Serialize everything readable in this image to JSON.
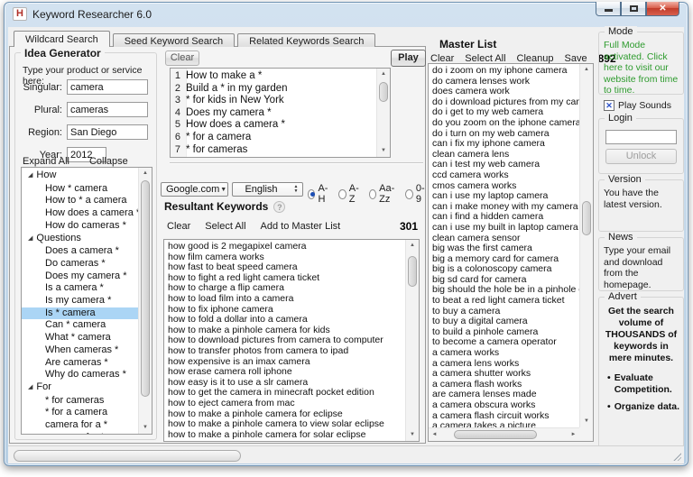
{
  "window": {
    "title": "Keyword Researcher 6.0"
  },
  "icons": {
    "app": "H",
    "close": "✕",
    "expander": "◢",
    "dropdown": "▼",
    "spin_up": "▲",
    "spin_down": "▼",
    "scroll_up": "▲",
    "scroll_down": "▼",
    "scroll_left": "◄",
    "scroll_right": "►",
    "help": "?",
    "check": "✕",
    "bullet": "•"
  },
  "colors": {
    "mode_message": "#2e9b2e",
    "tree_selection": "#abd5f5",
    "radio_dot": "#1c4eb4",
    "checkbox_check": "#2b51c9",
    "close_button": "#c03a28"
  },
  "tabs": [
    {
      "label": "Wildcard Search",
      "active": true
    },
    {
      "label": "Seed Keyword Search",
      "active": false
    },
    {
      "label": "Related Keywords Search",
      "active": false
    }
  ],
  "idea_generator": {
    "title": "Idea Generator",
    "instruction": "Type your product or service here:",
    "fields": [
      {
        "name": "singular",
        "label": "Singular:",
        "value": "camera"
      },
      {
        "name": "plural",
        "label": "Plural:",
        "value": "cameras"
      },
      {
        "name": "region",
        "label": "Region:",
        "value": "San Diego"
      },
      {
        "name": "year",
        "label": "Year:",
        "value": "2012"
      }
    ],
    "expand_all_label": "Expand All",
    "collapse_all_label": "Collapse All",
    "tree": [
      {
        "label": "How",
        "expanded": true,
        "children": [
          {
            "label": "How * camera"
          },
          {
            "label": "How to * a camera"
          },
          {
            "label": "How does a camera *"
          },
          {
            "label": "How do cameras *"
          }
        ]
      },
      {
        "label": "Questions",
        "expanded": true,
        "children": [
          {
            "label": "Does a camera *"
          },
          {
            "label": "Do cameras *"
          },
          {
            "label": "Does my camera *"
          },
          {
            "label": "Is a camera *"
          },
          {
            "label": "Is my camera *"
          },
          {
            "label": "Is * camera",
            "selected": true
          },
          {
            "label": "Can * camera"
          },
          {
            "label": "What * camera"
          },
          {
            "label": "When cameras *"
          },
          {
            "label": "Are cameras *"
          },
          {
            "label": "Why do cameras *"
          }
        ]
      },
      {
        "label": "For",
        "expanded": true,
        "children": [
          {
            "label": "* for cameras"
          },
          {
            "label": "* for a camera"
          },
          {
            "label": "camera for a *"
          },
          {
            "label": "cameras for *"
          }
        ]
      }
    ]
  },
  "wildcard_editor": {
    "clear_label": "Clear",
    "play_label": "Play",
    "lines": [
      "How to make a *",
      "Build a * in my garden",
      "* for kids in New York",
      "Does my camera *",
      "How does a camera *",
      "* for a camera",
      "* for cameras"
    ]
  },
  "search_options": {
    "engine": "Google.com",
    "language": "English",
    "letter_ranges": [
      {
        "label": "A-H",
        "selected": true
      },
      {
        "label": "A-Z",
        "selected": false
      },
      {
        "label": "Aa-Zz",
        "selected": false
      },
      {
        "label": "0-9",
        "selected": false
      }
    ]
  },
  "resultant_keywords": {
    "title": "Resultant Keywords",
    "actions": [
      {
        "label": "Clear"
      },
      {
        "label": "Select All"
      },
      {
        "label": "Add to Master List"
      }
    ],
    "count": "301",
    "items": [
      "how good is 2 megapixel camera",
      "how film camera works",
      "how fast to beat speed camera",
      "how to fight a red light camera ticket",
      "how to charge a flip camera",
      "how to load film into a camera",
      "how to fix iphone camera",
      "how to fold a dollar into a camera",
      "how to make a pinhole camera for kids",
      "how to download pictures from camera to computer",
      "how to transfer photos from camera to ipad",
      "how expensive is an imax camera",
      "how erase camera roll iphone",
      "how easy is it to use a slr camera",
      "how to get the camera in minecraft pocket edition",
      "how to eject camera from mac",
      "how to make a pinhole camera for eclipse",
      "how to make a pinhole camera to view solar eclipse",
      "how to make a pinhole camera for solar eclipse"
    ]
  },
  "master_list": {
    "title": "Master List",
    "actions": [
      {
        "label": "Clear"
      },
      {
        "label": "Select All"
      },
      {
        "label": "Cleanup"
      },
      {
        "label": "Save"
      }
    ],
    "count": "892",
    "items": [
      "do i zoom on my iphone camera",
      "do camera lenses work",
      "does camera work",
      "do i download pictures from my came",
      "do i get to my web camera",
      "do you zoom on the iphone camera",
      "do i turn on my web camera",
      "can i fix my iphone camera",
      "clean camera lens",
      "can i test my web camera",
      "ccd camera works",
      "cmos camera works",
      "can i use my laptop camera",
      "can i make money with my camera",
      "can i find a hidden camera",
      "can i use my built in laptop camera",
      "clean camera sensor",
      "big was the first camera",
      "big a memory card for camera",
      "big is a colonoscopy camera",
      "big sd card for camera",
      "big should the hole be in a pinhole ca",
      "to beat a red light camera ticket",
      "to buy a camera",
      "to buy a digital camera",
      "to build a pinhole camera",
      "to become a camera operator",
      "a camera works",
      "a camera lens works",
      "a camera shutter works",
      "a camera flash works",
      "are camera lenses made",
      "a camera obscura works",
      "a camera flash circuit works",
      "a camera takes a picture"
    ]
  },
  "sidebar": {
    "mode": {
      "title": "Mode",
      "message": "Full Mode activated. Click here to visit our website from time to time.",
      "play_sounds_label": "Play Sounds",
      "play_sounds_checked": true
    },
    "login": {
      "title": "Login",
      "input_value": "",
      "unlock_label": "Unlock"
    },
    "version": {
      "title": "Version",
      "message": "You have the latest version."
    },
    "news": {
      "title": "News",
      "message": "Type your email and download from the homepage."
    },
    "advert": {
      "title": "Advert",
      "headline": "Get the search volume of THOUSANDS of keywords in mere minutes.",
      "bullets": [
        "Evaluate Competition.",
        "Organize data."
      ]
    }
  }
}
